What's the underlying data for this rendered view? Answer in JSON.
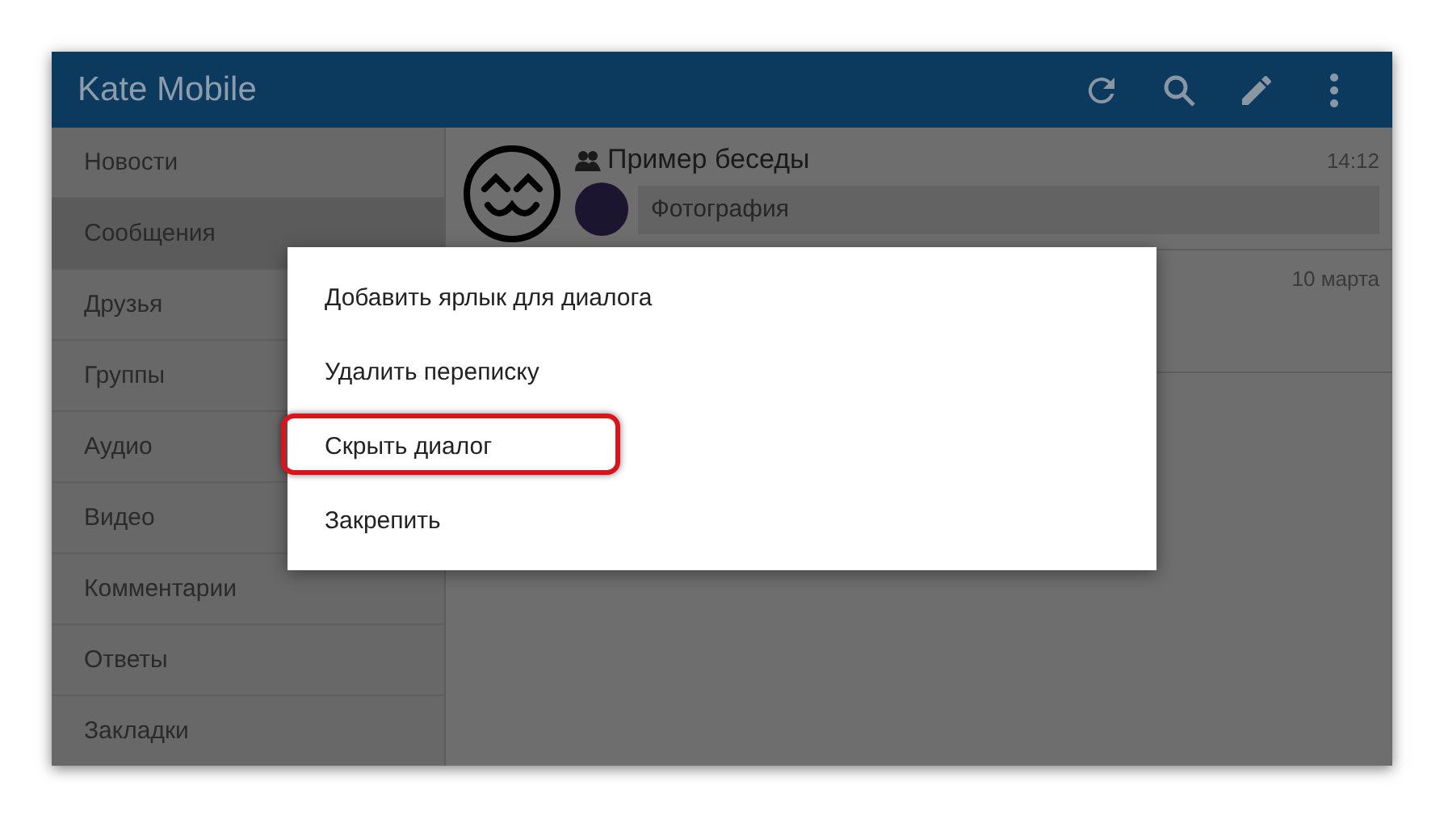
{
  "app_bar": {
    "title": "Kate Mobile",
    "actions": [
      {
        "kind": "refresh"
      },
      {
        "kind": "search"
      },
      {
        "kind": "edit"
      },
      {
        "kind": "more"
      }
    ]
  },
  "sidebar": {
    "items": [
      {
        "label": "Новости",
        "selected": false
      },
      {
        "label": "Сообщения",
        "selected": true
      },
      {
        "label": "Друзья",
        "selected": false
      },
      {
        "label": "Группы",
        "selected": false
      },
      {
        "label": "Аудио",
        "selected": false
      },
      {
        "label": "Видео",
        "selected": false
      },
      {
        "label": "Комментарии",
        "selected": false
      },
      {
        "label": "Ответы",
        "selected": false
      },
      {
        "label": "Закладки",
        "selected": false
      }
    ]
  },
  "conversations": [
    {
      "title": "Пример беседы",
      "group": true,
      "time": "14:12",
      "preview": "Фотография"
    },
    {
      "time": "10 марта"
    }
  ],
  "dialog": {
    "items": [
      {
        "label": "Добавить ярлык для диалога",
        "highlighted": false
      },
      {
        "label": "Удалить переписку",
        "highlighted": false
      },
      {
        "label": "Скрыть диалог",
        "highlighted": true
      },
      {
        "label": "Закрепить",
        "highlighted": false
      }
    ]
  }
}
